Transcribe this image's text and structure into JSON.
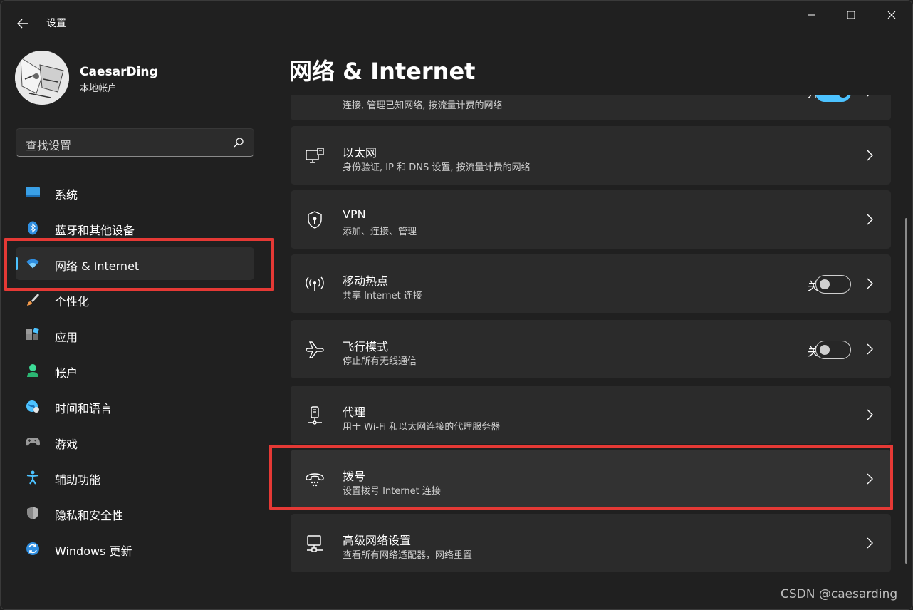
{
  "window": {
    "title": "设置",
    "controls": [
      "minimize",
      "maximize",
      "close"
    ]
  },
  "profile": {
    "name": "CaesarDing",
    "account_type": "本地帐户"
  },
  "search": {
    "placeholder": "查找设置"
  },
  "sidebar": {
    "items": [
      {
        "label": "系统",
        "icon": "system-icon"
      },
      {
        "label": "蓝牙和其他设备",
        "icon": "bluetooth-icon"
      },
      {
        "label": "网络 & Internet",
        "icon": "wifi-icon",
        "active": true
      },
      {
        "label": "个性化",
        "icon": "brush-icon"
      },
      {
        "label": "应用",
        "icon": "apps-icon"
      },
      {
        "label": "帐户",
        "icon": "account-icon"
      },
      {
        "label": "时间和语言",
        "icon": "globe-clock-icon"
      },
      {
        "label": "游戏",
        "icon": "gamepad-icon"
      },
      {
        "label": "辅助功能",
        "icon": "accessibility-icon"
      },
      {
        "label": "隐私和安全性",
        "icon": "shield-icon"
      },
      {
        "label": "Windows 更新",
        "icon": "update-icon"
      }
    ]
  },
  "page": {
    "title": "网络 & Internet"
  },
  "cards": [
    {
      "title": "",
      "subtitle": "连接, 管理已知网络, 按流量计费的网络",
      "icon": "wifi-card-icon",
      "toggle_label": "开",
      "toggle_on": true
    },
    {
      "title": "以太网",
      "subtitle": "身份验证, IP 和 DNS 设置, 按流量计费的网络",
      "icon": "ethernet-icon"
    },
    {
      "title": "VPN",
      "subtitle": "添加、连接、管理",
      "icon": "vpn-shield-icon"
    },
    {
      "title": "移动热点",
      "subtitle": "共享 Internet 连接",
      "icon": "hotspot-icon",
      "toggle_label": "关",
      "toggle_on": false
    },
    {
      "title": "飞行模式",
      "subtitle": "停止所有无线通信",
      "icon": "airplane-icon",
      "toggle_label": "关",
      "toggle_on": false
    },
    {
      "title": "代理",
      "subtitle": "用于 Wi-Fi 和以太网连接的代理服务器",
      "icon": "proxy-icon"
    },
    {
      "title": "拨号",
      "subtitle": "设置拨号 Internet 连接",
      "icon": "dialup-icon"
    },
    {
      "title": "高级网络设置",
      "subtitle": "查看所有网络适配器，网络重置",
      "icon": "network-adapter-icon"
    }
  ],
  "watermark": "CSDN @caesarding",
  "colors": {
    "accent": "#4cc2ff",
    "highlight": "#e53935",
    "background": "#202020",
    "card": "#2b2b2b"
  }
}
